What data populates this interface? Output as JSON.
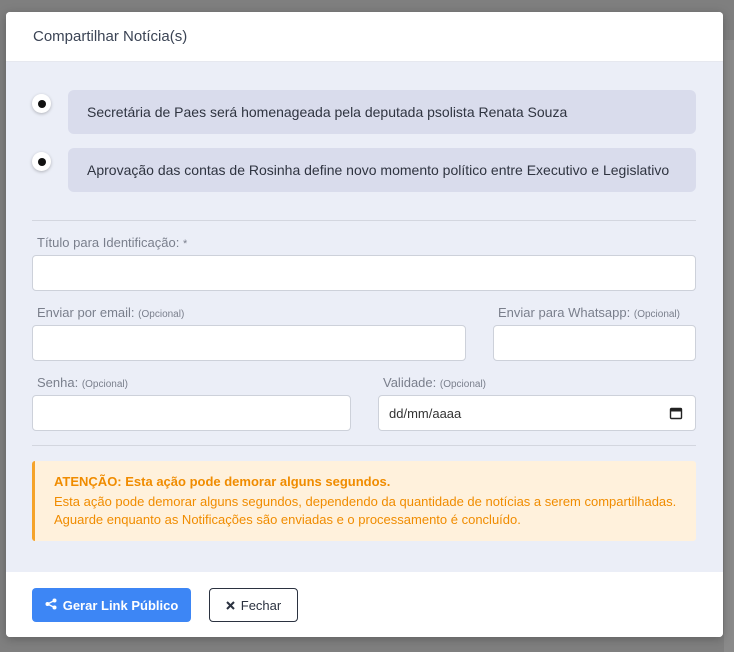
{
  "modal": {
    "title": "Compartilhar Notícia(s)"
  },
  "news": [
    {
      "title": "Secretária de Paes será homenageada pela deputada psolista Renata Souza"
    },
    {
      "title": "Aprovação das contas de Rosinha define novo momento político entre Executivo e Legislativo"
    }
  ],
  "form": {
    "title_label": "Título para Identificação:",
    "title_required": "*",
    "email_label": "Enviar por email:",
    "email_optional": "(Opcional)",
    "whatsapp_label": "Enviar para Whatsapp:",
    "whatsapp_optional": "(Opcional)",
    "password_label": "Senha:",
    "password_optional": "(Opcional)",
    "validity_label": "Validade:",
    "validity_optional": "(Opcional)",
    "validity_placeholder": "dd/mm/aaaa"
  },
  "alert": {
    "title": "ATENÇÃO: Esta ação pode demorar alguns segundos.",
    "text": "Esta ação pode demorar alguns segundos, dependendo da quantidade de notícias a serem compartilhadas. Aguarde enquanto as Notificações são enviadas e o processamento é concluído."
  },
  "footer": {
    "primary_label": "Gerar Link Público",
    "close_label": "Fechar"
  },
  "colors": {
    "primary": "#3d86f5",
    "warning": "#f08c00",
    "body_bg": "#ebeef7"
  }
}
